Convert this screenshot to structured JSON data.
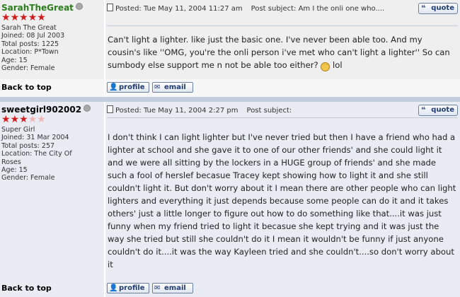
{
  "posts": [
    {
      "username": "SarahTheGreat",
      "stars_filled": 5,
      "stars_total": 5,
      "title": "Sarah The Great",
      "joined": "Joined: 08 Jul 2003",
      "total_posts": "Total posts: 1225",
      "location": "Location: P*Town",
      "age": "Age: 15",
      "gender": "Gender: Female",
      "posted": "Posted: Tue May 11, 2004 11:27 am",
      "subject": "Post subject: Am I the onli one who....",
      "body": "Can't light a lighter. like just the basic one. I've never been able too. And my cousin's like ''OMG, you're the onli person i've met who can't light a lighter'' So can sumbody else support me n not be able too either?",
      "body_after_smiley": "lol",
      "back_to_top": "Back to top",
      "quote_label": "quote",
      "profile_label": "profile",
      "email_label": "email"
    },
    {
      "username": "sweetgirl902002",
      "stars_filled": 3,
      "stars_total": 5,
      "title": "Super Girl",
      "joined": "Joined: 31 Mar 2004",
      "total_posts": "Total posts: 257",
      "location": "Location: The City Of Roses",
      "age": "Age: 15",
      "gender": "Gender: Female",
      "posted": "Posted: Tue May 11, 2004 2:27 pm",
      "subject": "Post subject:",
      "body": "I don't think I can light lighter but I've never tried but then I have a friend who had a lighter at school and she gave it to one of our other friends' and she could light it and we were all sitting by the lockers in a HUGE group of friends' and she made such a fool of herslef becasue Tracey kept showing how to light it and she still couldn't light it. But don't worry about it I mean there are other people who can light lighters and everything it just depends because some people can do it and it takes others' just a little longer to figure out how to do something like that....it was just funny when my friend tried to light it becasue she kept trying and it was just the way she tried but still she couldn't do it I mean it wouldn't be funny if just anyone couldn't do it....it was the way Kayleen tried and she couldn't....so don't worry about it",
      "back_to_top": "Back to top",
      "quote_label": "quote",
      "profile_label": "profile",
      "email_label": "email"
    }
  ],
  "colors": {
    "username_1": "#2a7d1a",
    "star_on": "#d21b1b",
    "star_off": "#f0b5b5",
    "separator": "#c2cedd"
  },
  "icons": {
    "status": "offline-status-icon",
    "post": "post-doc-icon",
    "smiley": "confused-smiley-icon",
    "profile": "profile-icon",
    "email": "email-icon",
    "quote": "quote-icon"
  }
}
